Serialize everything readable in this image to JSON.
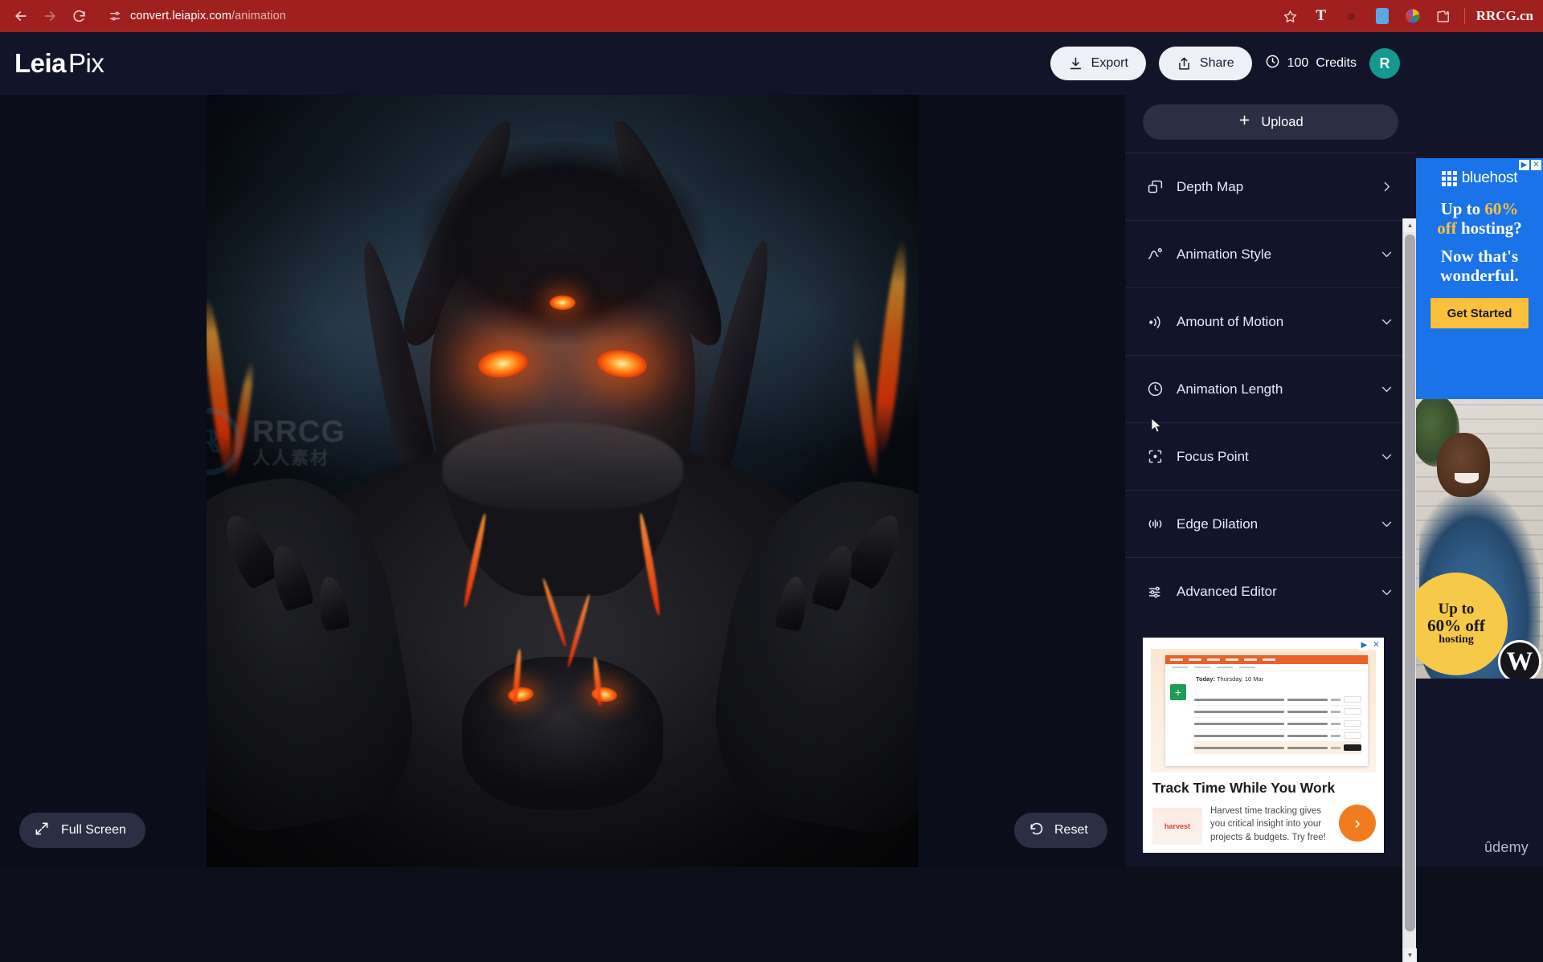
{
  "browser": {
    "back_icon": "back-arrow-icon",
    "forward_icon": "forward-arrow-icon",
    "reload_icon": "reload-icon",
    "site_info_icon": "site-settings-icon",
    "url_domain": "convert.leiapix.com",
    "url_path": "/animation",
    "bookmark_icon": "star-icon",
    "extensions": [
      "text-extension-icon",
      "dot-extension-icon",
      "blue-extension-icon",
      "color-wheel-extension-icon",
      "puzzle-extension-icon"
    ],
    "profile_brand": "RRCG.cn"
  },
  "header": {
    "logo_bold": "Leia",
    "logo_light": "Pix",
    "export_label": "Export",
    "export_icon": "download-icon",
    "share_label": "Share",
    "share_icon": "share-upload-icon",
    "credits_icon": "clock-icon",
    "credits_value": "100",
    "credits_label": "Credits",
    "avatar_initial": "R",
    "avatar_color": "#15998f"
  },
  "sidebar": {
    "upload_label": "Upload",
    "upload_icon": "plus-icon",
    "items": [
      {
        "label": "Depth Map",
        "icon": "layers-icon",
        "chevron": "chevron-right-icon"
      },
      {
        "label": "Animation Style",
        "icon": "motion-path-icon",
        "chevron": "chevron-down-icon"
      },
      {
        "label": "Amount of Motion",
        "icon": "motion-waves-icon",
        "chevron": "chevron-down-icon"
      },
      {
        "label": "Animation Length",
        "icon": "clock-icon",
        "chevron": "chevron-down-icon"
      },
      {
        "label": "Focus Point",
        "icon": "focus-target-icon",
        "chevron": "chevron-down-icon"
      },
      {
        "label": "Edge Dilation",
        "icon": "edge-dilation-icon",
        "chevron": "chevron-down-icon"
      },
      {
        "label": "Advanced Editor",
        "icon": "sliders-icon",
        "chevron": "chevron-down-icon"
      }
    ],
    "scrollbar": {
      "up_icon": "scroll-up-arrow-icon",
      "down_icon": "scroll-down-arrow-icon"
    }
  },
  "canvas": {
    "full_screen_label": "Full Screen",
    "full_screen_icon": "expand-arrows-icon",
    "reset_label": "Reset",
    "reset_icon": "undo-circular-arrow-icon",
    "watermark_text": "RRCG",
    "watermark_subtext": "人人素材",
    "watermark_accent": "#2196d6"
  },
  "ads": {
    "ad_choices_icon": "ad-choices-triangle-icon",
    "ad_close_icon": "close-x-icon",
    "bluehost": {
      "brand": "bluehost",
      "line1_a": "Up to ",
      "line1_b": "60%",
      "line2_a": "off",
      "line2_b": " hosting?",
      "line3": "Now that's",
      "line4": "wonderful.",
      "cta": "Get Started",
      "bg_color": "#1a73e8",
      "cta_color": "#fbc13c"
    },
    "hosting_photo": {
      "badge_line1": "Up to",
      "badge_line2": "60% off",
      "badge_line3": "hosting",
      "wordpress_mark": "W",
      "badge_color": "#f7c948"
    },
    "harvest": {
      "screenshot_title": "Today:",
      "screenshot_date": " Thursday, 10 Mar",
      "headline": "Track Time While You Work",
      "logo_text": "harvest",
      "body": "Harvest time tracking gives you critical insight into your projects & budgets. Try free!",
      "arrow_icon": "chevron-right-circle-icon",
      "arrow_color": "#f07c1f"
    },
    "network_label": "ûdemy"
  }
}
